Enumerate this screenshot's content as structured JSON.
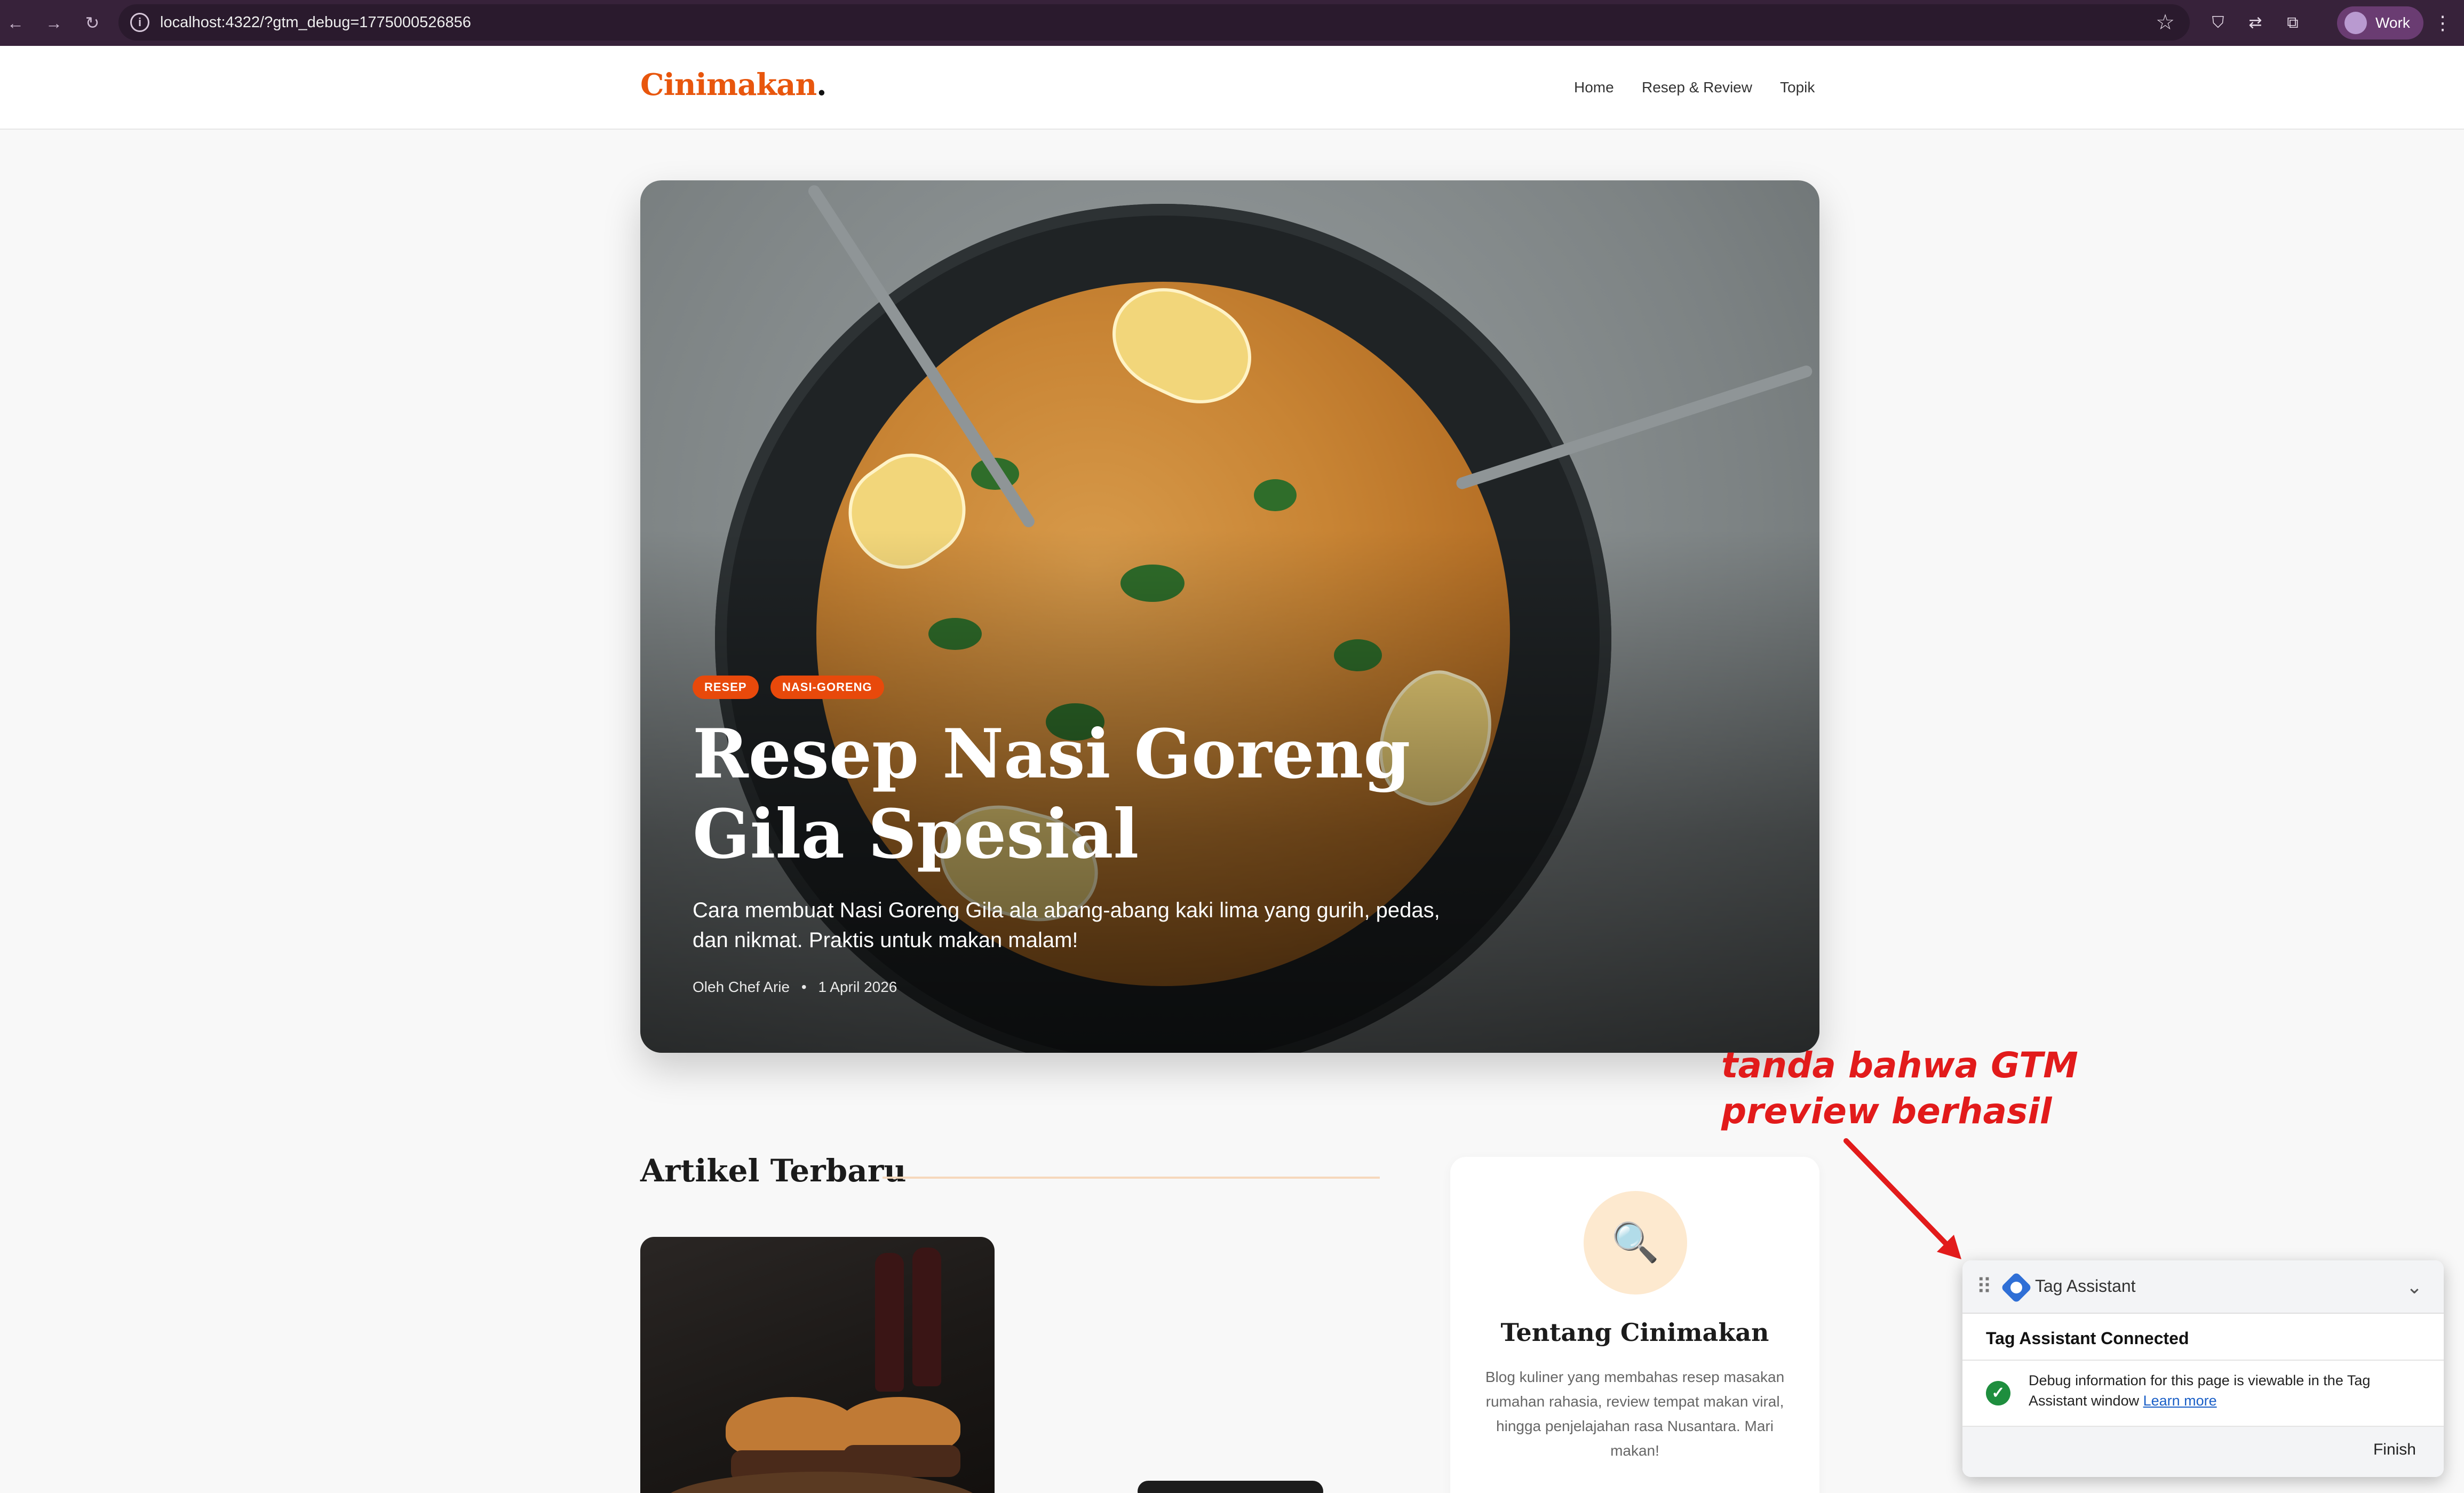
{
  "browser": {
    "url": "localhost:4322/?gtm_debug=1775000526856",
    "profile_label": "Work"
  },
  "site": {
    "logo_text": "Cinimakan",
    "logo_dot": ".",
    "nav": [
      "Home",
      "Resep & Review",
      "Topik"
    ]
  },
  "hero": {
    "tags": [
      "RESEP",
      "NASI-GORENG"
    ],
    "title": "Resep Nasi Goreng Gila Spesial",
    "subtitle": "Cara membuat Nasi Goreng Gila ala abang-abang kaki lima yang gurih, pedas, dan nikmat. Praktis untuk makan malam!",
    "author": "Oleh Chef Arie",
    "separator": "•",
    "date": "1 April 2026"
  },
  "latest": {
    "title": "Artikel Terbaru"
  },
  "about": {
    "icon": "magnifier-icon",
    "title": "Tentang Cinimakan",
    "text": "Blog kuliner yang membahas resep masakan rumahan rahasia, review tempat makan viral, hingga penjelajahan rasa Nusantara. Mari makan!"
  },
  "annotation": {
    "text": "tanda bahwa GTM preview berhasil",
    "color": "#e21b1b"
  },
  "tag_assistant": {
    "name": "Tag Assistant",
    "status": "Tag Assistant Connected",
    "message": "Debug information for this page is viewable in the Tag Assistant window",
    "link": "Learn more",
    "finish": "Finish"
  },
  "colors": {
    "brand": "#e8560d",
    "tag": "#e8490b",
    "success": "#1e8e3e"
  }
}
